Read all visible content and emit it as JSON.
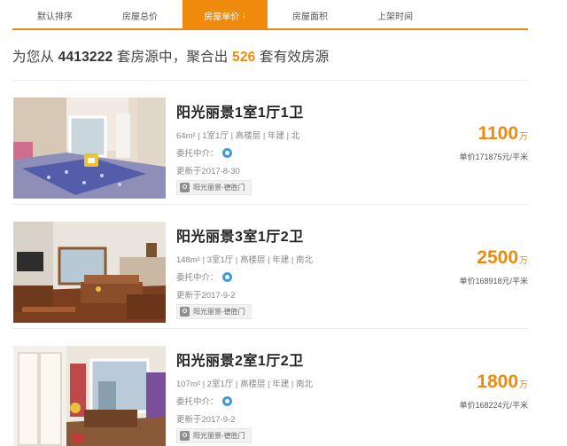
{
  "sort_tabs": [
    {
      "label": "默认排序",
      "active": false
    },
    {
      "label": "房屋总价",
      "active": false
    },
    {
      "label": "房屋单价",
      "active": true,
      "arrow": "↓"
    },
    {
      "label": "房屋面积",
      "active": false
    },
    {
      "label": "上架时间",
      "active": false
    }
  ],
  "summary": {
    "prefix": "为您从",
    "total": "4413222",
    "middle": "套房源中，聚合出",
    "matched": "526",
    "suffix": "套有效房源"
  },
  "listings": [
    {
      "title": "阳光丽景1室1厅1卫",
      "info": "64m² | 1室1厅 | 高楼层 | 年建 | 北",
      "agent_label": "委托中介：",
      "updated": "更新于2017-8-30",
      "tag": "阳光丽景-德胜门",
      "price": "1100",
      "price_unit": "万",
      "unit_price": "单价171875元/平米",
      "photo_icon": "bedroom-photo"
    },
    {
      "title": "阳光丽景3室1厅2卫",
      "info": "148m² | 3室1厅 | 高楼层 | 年建 | 南北",
      "agent_label": "委托中介：",
      "updated": "更新于2017-9-2",
      "tag": "阳光丽景-德胜门",
      "price": "2500",
      "price_unit": "万",
      "unit_price": "单价168918元/平米",
      "photo_icon": "living-room-photo"
    },
    {
      "title": "阳光丽景2室1厅2卫",
      "info": "107m² | 2室1厅 | 高楼层 | 年建 | 南北",
      "agent_label": "委托中介：",
      "updated": "更新于2017-9-2",
      "tag": "阳光丽景-德胜门",
      "price": "1800",
      "price_unit": "万",
      "unit_price": "单价168224元/平米",
      "photo_icon": "room-photo"
    }
  ],
  "colors": {
    "accent": "#f08a0c",
    "badge_blue": "#3a9cde"
  }
}
